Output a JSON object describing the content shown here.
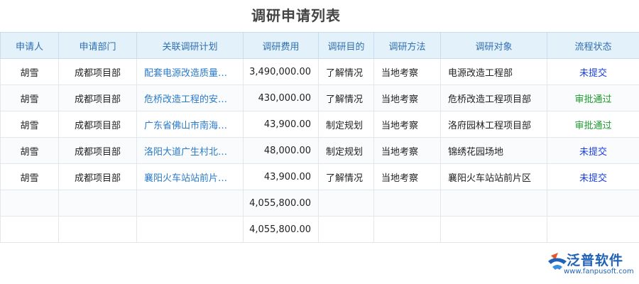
{
  "title": "调研申请列表",
  "columns": [
    "申请人",
    "申请部门",
    "关联调研计划",
    "调研费用",
    "调研目的",
    "调研方法",
    "调研对象",
    "流程状态"
  ],
  "rows": [
    {
      "applicant": "胡雪",
      "dept": "成都项目部",
      "plan": "配套电源改造质量…",
      "cost": "3,490,000.00",
      "purpose": "了解情况",
      "method": "当地考察",
      "target": "电源改造工程部",
      "status": "未提交"
    },
    {
      "applicant": "胡雪",
      "dept": "成都项目部",
      "plan": "危桥改造工程的安…",
      "cost": "430,000.00",
      "purpose": "了解情况",
      "method": "当地考察",
      "target": "危桥改造工程项目部",
      "status": "审批通过"
    },
    {
      "applicant": "胡雪",
      "dept": "成都项目部",
      "plan": "广东省佛山市南海…",
      "cost": "43,900.00",
      "purpose": "制定规划",
      "method": "当地考察",
      "target": "洛府园林工程项目部",
      "status": "审批通过"
    },
    {
      "applicant": "胡雪",
      "dept": "成都项目部",
      "plan": "洛阳大道广生村北…",
      "cost": "48,000.00",
      "purpose": "制定规划",
      "method": "当地考察",
      "target": "锦绣花园场地",
      "status": "未提交"
    },
    {
      "applicant": "胡雪",
      "dept": "成都项目部",
      "plan": "襄阳火车站站前片…",
      "cost": "43,900.00",
      "purpose": "了解情况",
      "method": "当地考察",
      "target": "襄阳火车站站前片区",
      "status": "未提交"
    }
  ],
  "totals": [
    "4,055,800.00",
    "4,055,800.00"
  ],
  "logo": {
    "name": "泛普软件",
    "url": "www.fanpusoft.com"
  },
  "colors": {
    "header_bg": "#e3f1fb",
    "header_text": "#2f6fb0",
    "link": "#2a7ac8",
    "unsubmitted": "#1a3ee0",
    "approved": "#1e9b2e"
  }
}
